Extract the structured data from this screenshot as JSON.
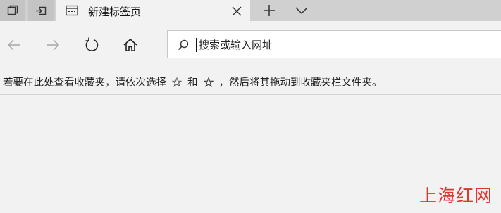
{
  "tabs": [
    {
      "title": "新建标签页",
      "active": true
    }
  ],
  "address_bar": {
    "placeholder": "搜索或输入网址"
  },
  "favorites_hint": {
    "text_before": "若要在此处查看收藏夹，请依次选择",
    "text_middle": "和",
    "text_after": "，然后将其拖动到收藏夹栏文件夹。"
  },
  "watermark": "上海红网",
  "icons": {
    "tab_actions": "tab-preview-icon",
    "set_aside": "set-aside-tabs-icon",
    "tab_favicon": "new-tab-page-icon",
    "close": "close-icon",
    "new_tab": "plus-icon",
    "tab_menu": "chevron-down-icon",
    "back": "back-arrow-icon",
    "forward": "forward-arrow-icon",
    "refresh": "refresh-icon",
    "home": "home-icon",
    "search": "search-icon",
    "star_outline": "star-outline-icon",
    "star": "star-icon"
  },
  "colors": {
    "tabbar_bg": "#d0d0d0",
    "page_bg": "#f2f2f2",
    "watermark": "#e0352e"
  }
}
